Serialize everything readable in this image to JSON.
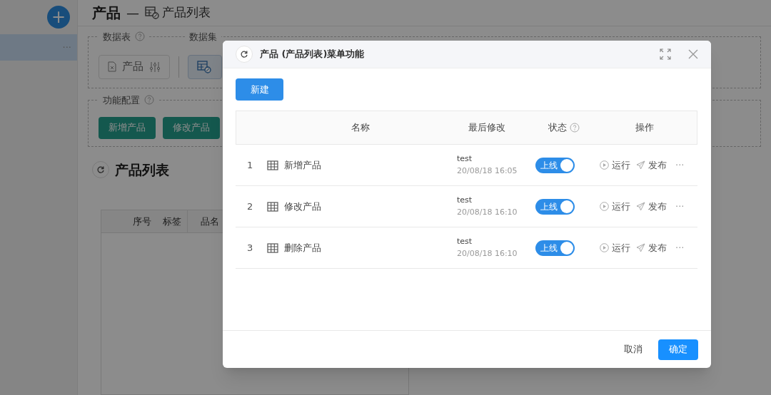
{
  "sidebar": {
    "add": "+",
    "items": [
      {
        "selected": true,
        "more": "···"
      }
    ]
  },
  "page": {
    "title": "产品",
    "separator": "—",
    "subtitle": "产品列表",
    "data_section": {
      "legend": "数据表",
      "legend2": "数据集",
      "tables": [
        {
          "label": "产品",
          "selected": false
        },
        {
          "selected": true
        }
      ]
    },
    "function_section": {
      "legend": "功能配置",
      "buttons": [
        "新增产品",
        "修改产品"
      ]
    },
    "list_title": "产品列表",
    "table": {
      "columns": [
        "序号",
        "标签",
        "品名"
      ]
    }
  },
  "dialog": {
    "title": "产品 (产品列表)菜单功能",
    "new_button": "新建",
    "columns": [
      "名称",
      "最后修改",
      "状态",
      "操作"
    ],
    "rows": [
      {
        "index": "1",
        "name": "新增产品",
        "user": "test",
        "time": "20/08/18 16:05",
        "status": {
          "label": "上线",
          "on": true
        },
        "actions": [
          "运行",
          "发布"
        ],
        "more": "···"
      },
      {
        "index": "2",
        "name": "修改产品",
        "user": "test",
        "time": "20/08/18 16:10",
        "status": {
          "label": "上线",
          "on": true
        },
        "actions": [
          "运行",
          "发布"
        ],
        "more": "···"
      },
      {
        "index": "3",
        "name": "删除产品",
        "user": "test",
        "time": "20/08/18 16:10",
        "status": {
          "label": "上线",
          "on": true
        },
        "actions": [
          "运行",
          "发布"
        ],
        "more": "···"
      }
    ],
    "cancel": "取消",
    "confirm": "确定"
  }
}
